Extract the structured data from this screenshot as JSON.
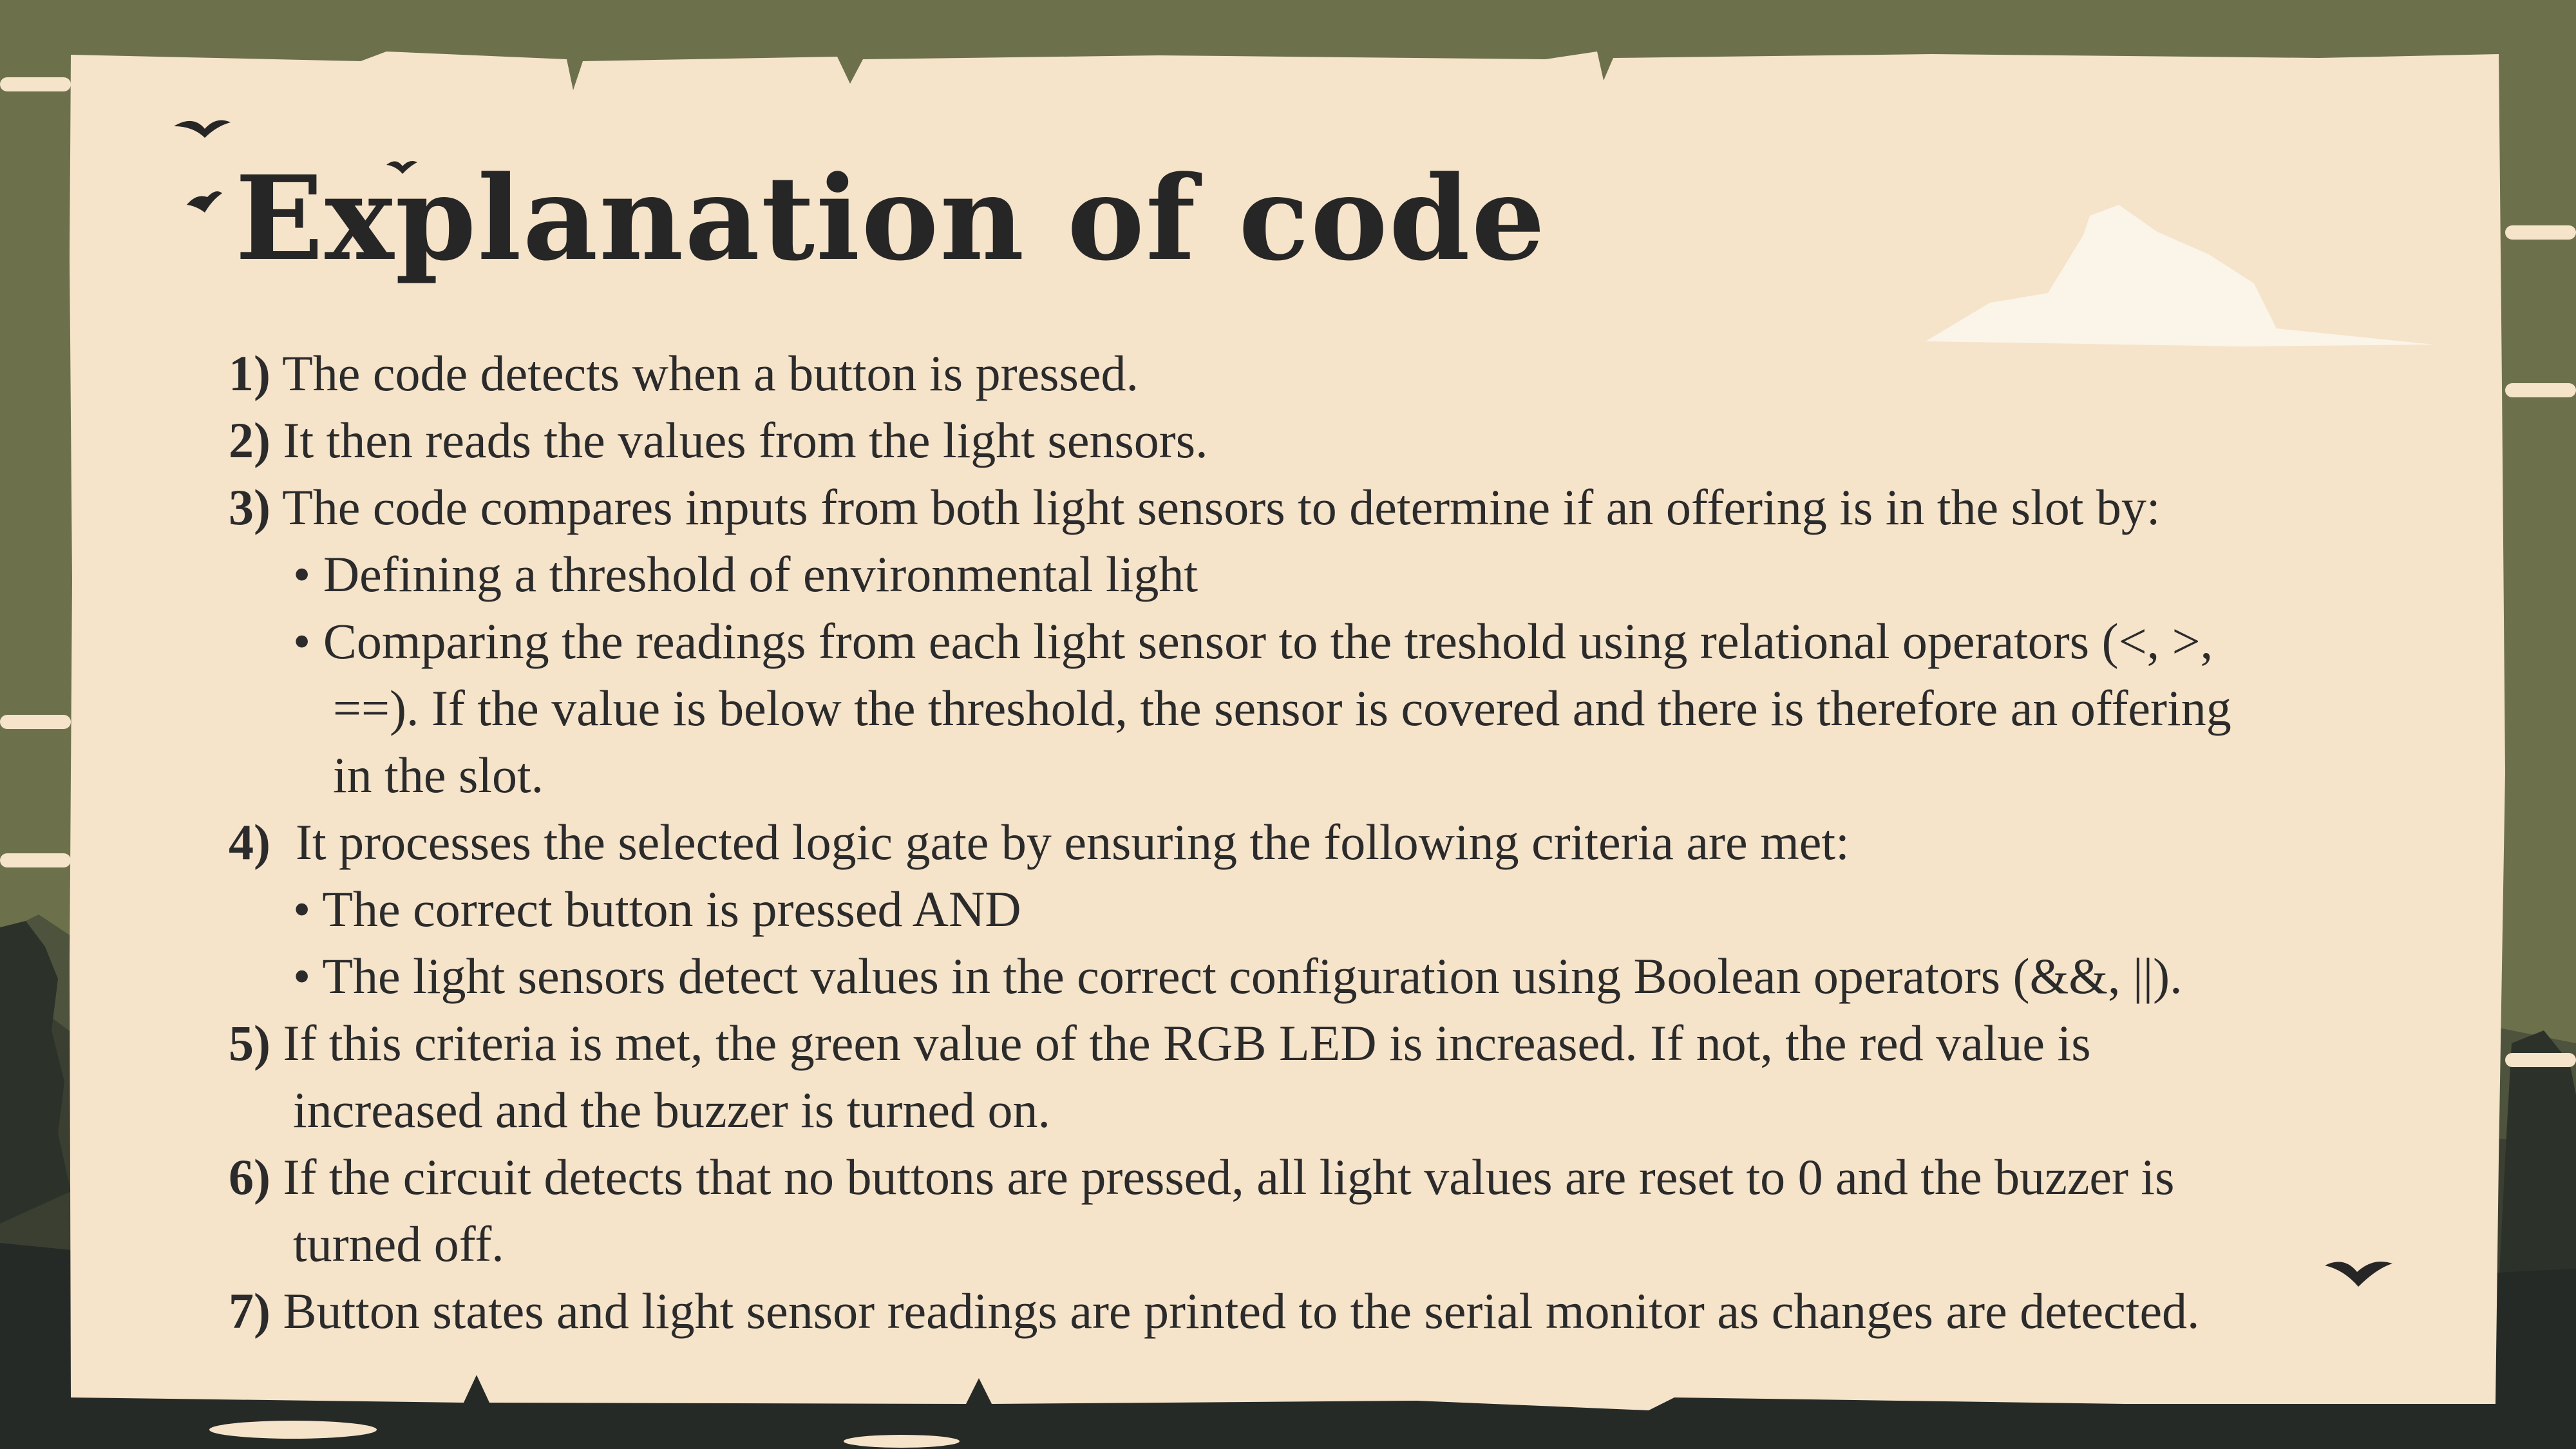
{
  "slide": {
    "title": "Explanation of code",
    "colors": {
      "background": "#6c714c",
      "parchment": "#f5e3ca",
      "text": "#2b2b2b",
      "cloud": "#fbf4e8",
      "forest_dark": "#262a27"
    },
    "icons": [
      "bird-icon",
      "cloud-icon"
    ],
    "items": [
      {
        "num": "1)",
        "text": "The code detects when a button is pressed."
      },
      {
        "num": "2)",
        "text": "It then reads the values from the light sensors."
      },
      {
        "num": "3)",
        "text": "The code compares inputs from both light sensors to determine if an offering is in the slot by:"
      },
      {
        "bullet": "•",
        "text": "Defining a threshold of environmental light"
      },
      {
        "bullet": "•",
        "text": "Comparing the readings from each light sensor to the treshold using relational operators (<, >,"
      },
      {
        "text": "==). If the value is below the threshold, the sensor is covered and there is therefore an offering"
      },
      {
        "text": "in the slot."
      },
      {
        "num": "4)",
        "text": " It processes the selected logic gate by ensuring the following criteria are met:"
      },
      {
        "bullet": "•",
        "text": "The correct button is pressed AND"
      },
      {
        "bullet": "•",
        "text": "The light sensors detect values in the correct configuration using Boolean operators (&&, ||)."
      },
      {
        "num": "5)",
        "text": "If this criteria is met, the green value of the RGB LED is increased. If not, the red value is"
      },
      {
        "text": "increased and the buzzer is turned on."
      },
      {
        "num": "6)",
        "text": "If the circuit detects that no buttons are pressed, all light values are reset to 0 and the buzzer is"
      },
      {
        "text": "turned off."
      },
      {
        "num": "7)",
        "text": "Button states and light sensor readings are printed to the serial monitor as changes are detected."
      }
    ]
  }
}
